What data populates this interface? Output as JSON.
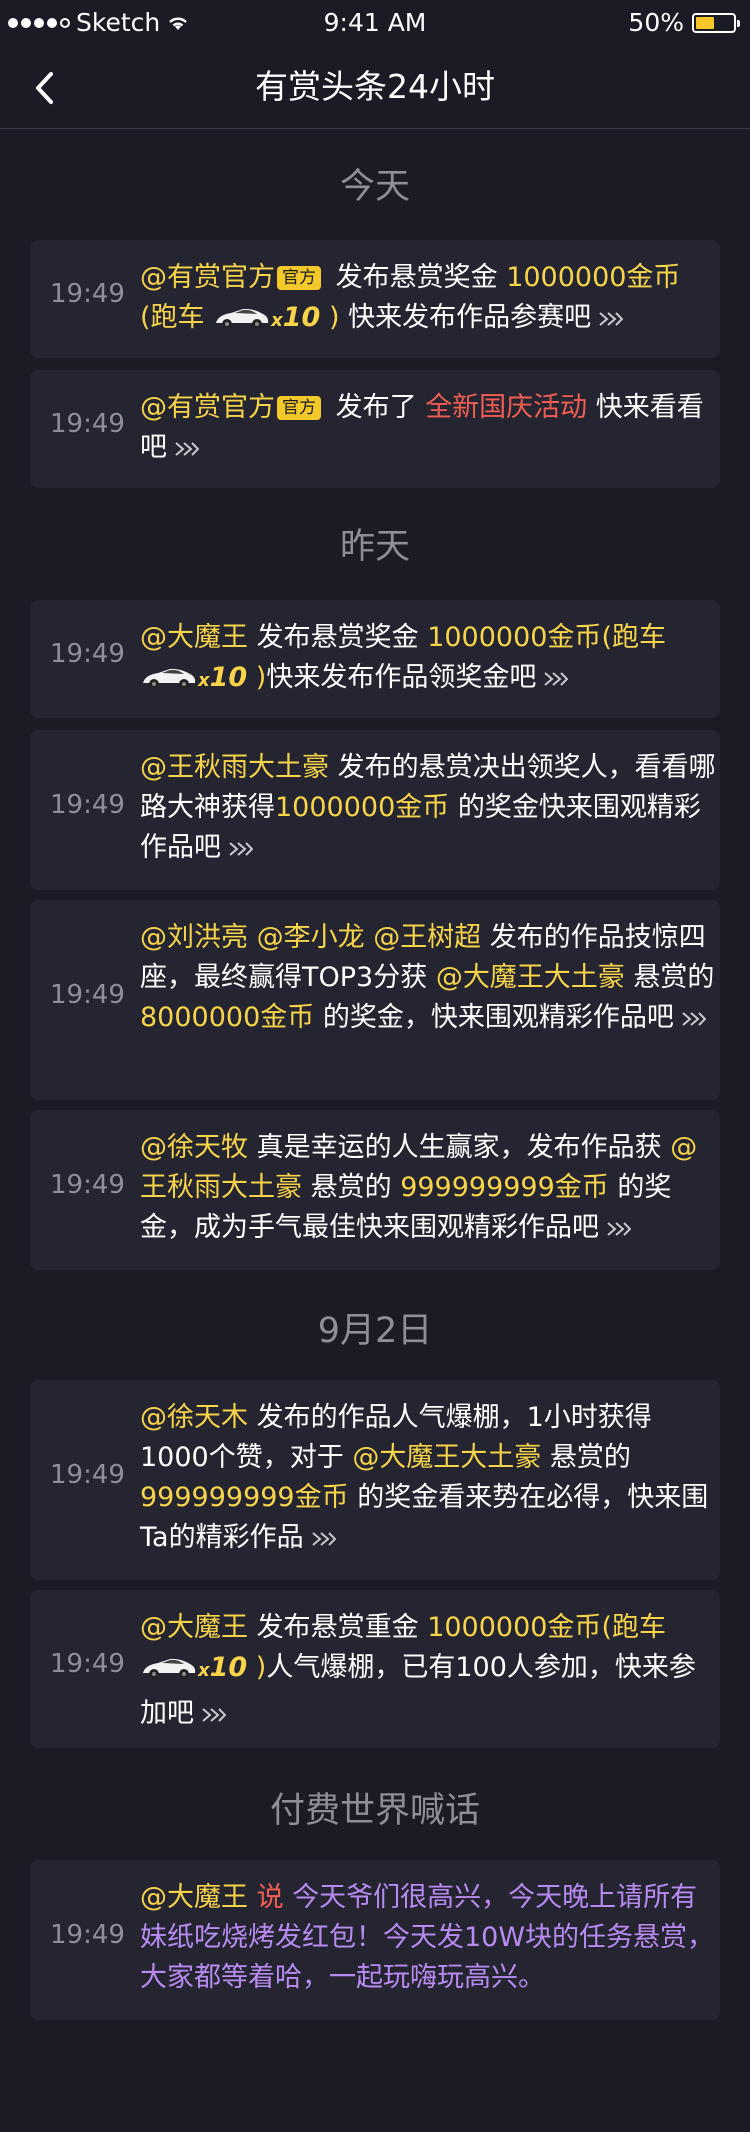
{
  "status_bar": {
    "carrier": "Sketch",
    "time": "9:41 AM",
    "battery": "50%",
    "battery_level": 0.5
  },
  "nav": {
    "title": "有赏头条24小时"
  },
  "sections": [
    {
      "title": "今天",
      "items": [
        {
          "time": "19:49",
          "user": "@有赏官方",
          "badge": "官方",
          "t1": "发布悬赏奖金",
          "amount": "1000000金币",
          "prize_open": "(跑车",
          "multiplier": "x10",
          "prize_close": ")",
          "t2": "快来发布作品参赛吧"
        },
        {
          "time": "19:49",
          "user": "@有赏官方",
          "badge": "官方",
          "t1": "发布了",
          "event": "全新国庆活动",
          "t2": "快来看看吧"
        }
      ]
    },
    {
      "title": "昨天",
      "items": [
        {
          "time": "19:49",
          "user": "@大魔王",
          "t1": "发布悬赏奖金",
          "amount": "1000000金币",
          "prize_open": "(跑车",
          "multiplier": "x10",
          "prize_close": ")",
          "t2": "快来发布作品领奖金吧"
        },
        {
          "time": "19:49",
          "user": "@王秋雨大土豪",
          "t1": "发布的悬赏决出领奖人，看看哪路大神获得",
          "amount": "1000000金币",
          "t2": "的奖金快来围观精彩作品吧"
        },
        {
          "time": "19:49",
          "user1": "@刘洪亮",
          "user2": "@李小龙",
          "user3": "@王树超",
          "t1": "发布的作品技惊四座，最终赢得TOP3分获",
          "sponsor": "@大魔王大土豪",
          "t2": "悬赏的",
          "amount": "8000000金币",
          "t3": "的奖金，快来围观精彩作品吧"
        },
        {
          "time": "19:49",
          "user": "@徐天牧",
          "t1": "真是幸运的人生赢家，发布作品获",
          "sponsor": "@王秋雨大土豪",
          "t2": "悬赏的",
          "amount": "999999999金币",
          "t3": "的奖金，成为手气最佳快来围观精彩作品吧"
        }
      ]
    },
    {
      "title": "9月2日",
      "items": [
        {
          "time": "19:49",
          "user": "@徐天木",
          "t1": "发布的作品人气爆棚，1小时获得1000个赞，对于",
          "sponsor": "@大魔王大土豪",
          "t2": "悬赏的",
          "amount": "999999999金币",
          "t3": "的奖金看来势在必得，快来围Ta的精彩作品"
        },
        {
          "time": "19:49",
          "user": "@大魔王",
          "t1": "发布悬赏重金",
          "amount": "1000000金币",
          "prize_open": "(跑车",
          "multiplier": "x10",
          "prize_close": ")",
          "t2": "人气爆棚，已有100人参加，快来参加吧"
        }
      ]
    },
    {
      "title": "付费世界喊话",
      "items": [
        {
          "time": "19:49",
          "user": "@大魔王",
          "say": "说",
          "message": "今天爷们很高兴，今天晚上请所有妹纸吃烧烤发红包！今天发10W块的任务悬赏，大家都等着哈，一起玩嗨玩高兴。"
        }
      ]
    }
  ],
  "colors": {
    "background": "#1a1b24",
    "card": "#242530",
    "highlight": "#f7d44a",
    "event_red": "#f15d52",
    "shout_purple": "#b88bf2",
    "time_gray": "#8e8f98"
  },
  "icons": {
    "back": "chevron-left-icon",
    "more": "double-chevron-right-icon",
    "car": "sports-car-icon",
    "wifi": "wifi-icon",
    "battery": "battery-icon"
  }
}
